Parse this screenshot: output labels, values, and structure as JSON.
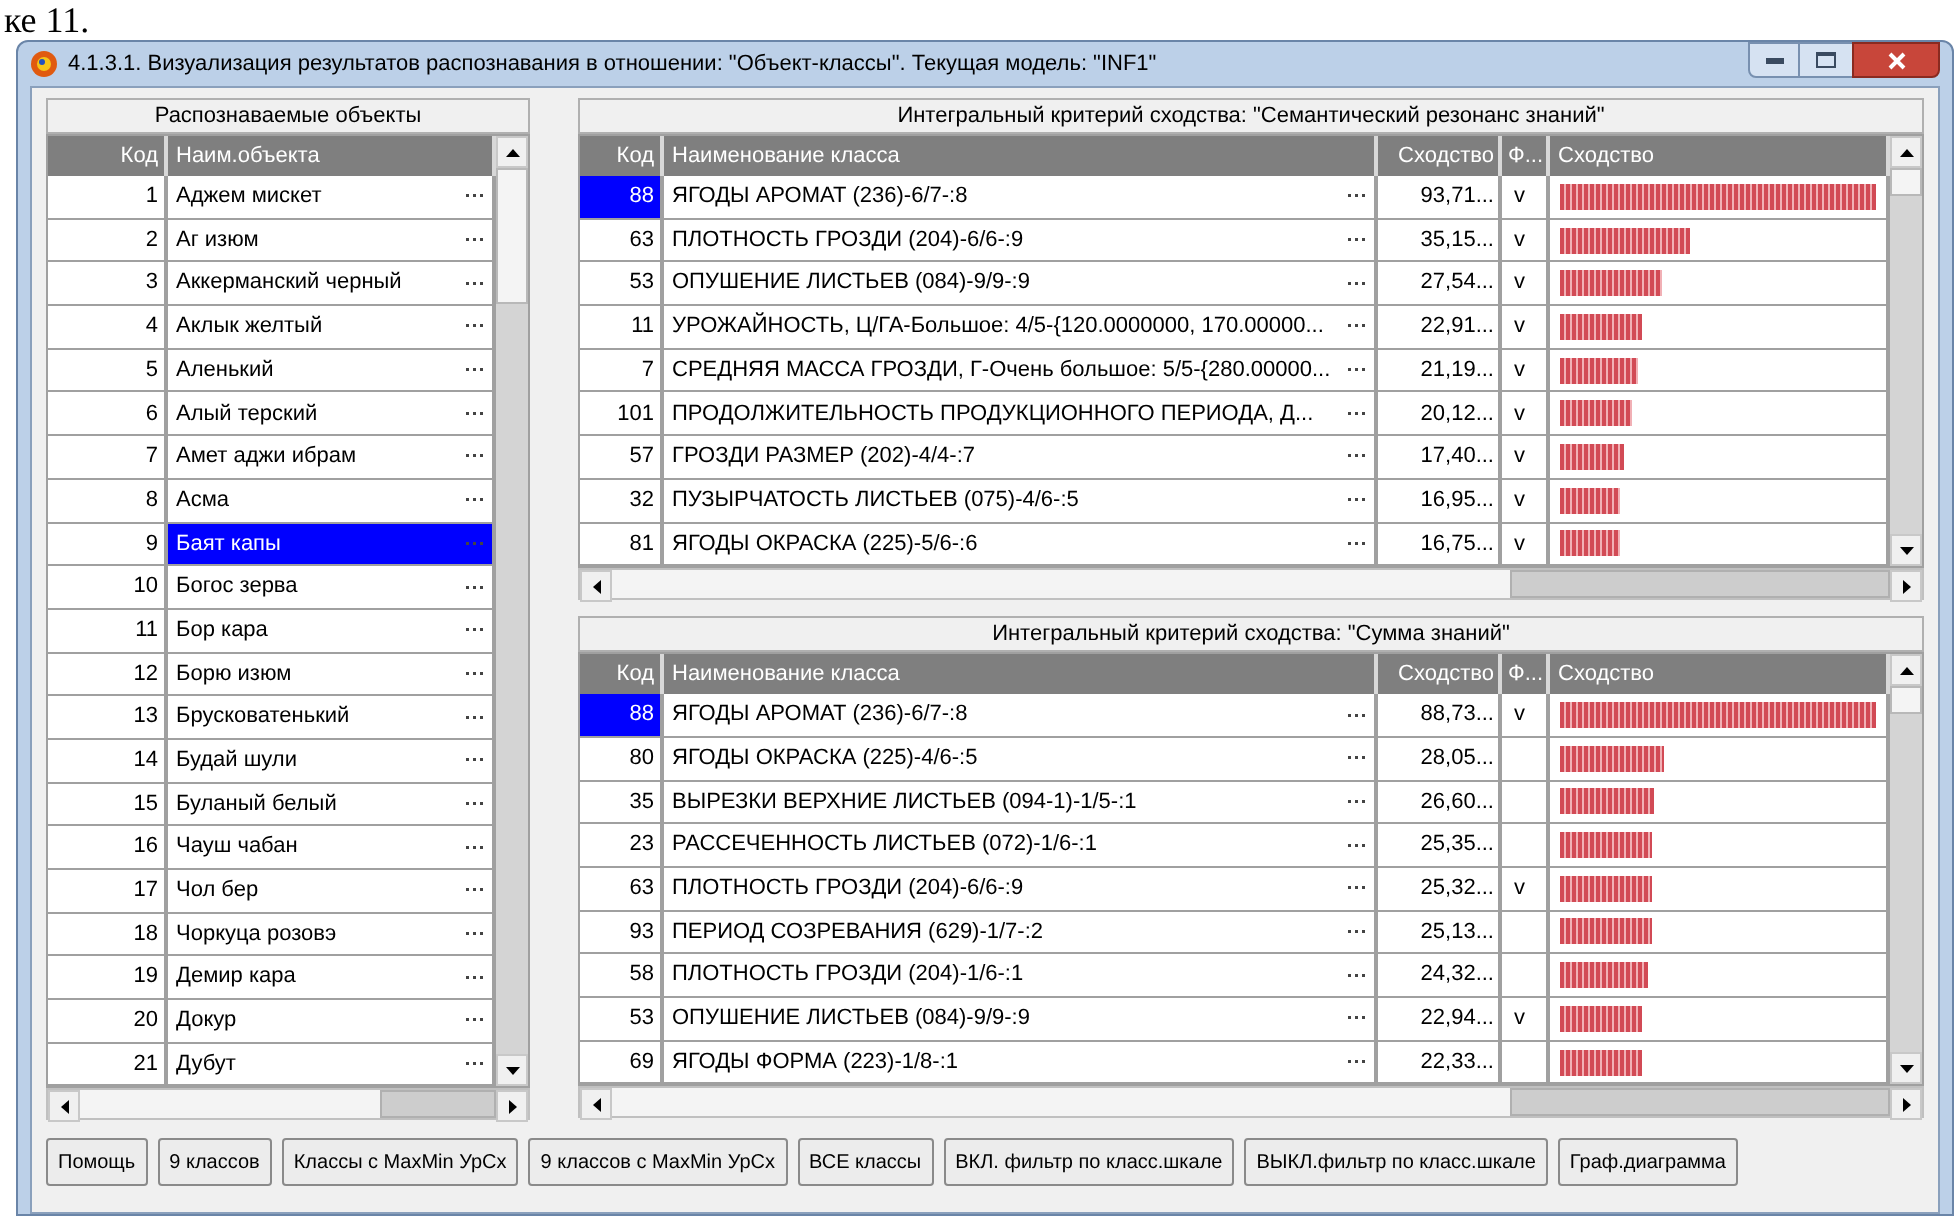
{
  "document_fragment": "ке 11.",
  "window": {
    "title": "4.1.3.1. Визуализация результатов распознавания в отношении: \"Объект-классы\". Текущая модель: \"INF1\""
  },
  "objects_panel": {
    "title": "Распознаваемые объекты",
    "columns": [
      "Код",
      "Наим.объекта"
    ],
    "rows": [
      {
        "code": "1",
        "name": "Аджем мискет",
        "selected": false
      },
      {
        "code": "2",
        "name": "Аг изюм",
        "selected": false
      },
      {
        "code": "3",
        "name": "Аккерманский черный",
        "selected": false
      },
      {
        "code": "4",
        "name": "Аклык желтый",
        "selected": false
      },
      {
        "code": "5",
        "name": "Аленький",
        "selected": false
      },
      {
        "code": "6",
        "name": "Алый терский",
        "selected": false
      },
      {
        "code": "7",
        "name": "Амет аджи ибрам",
        "selected": false
      },
      {
        "code": "8",
        "name": "Асма",
        "selected": false
      },
      {
        "code": "9",
        "name": "Баят капы",
        "selected": true
      },
      {
        "code": "10",
        "name": "Богос зерва",
        "selected": false
      },
      {
        "code": "11",
        "name": "Бор кара",
        "selected": false
      },
      {
        "code": "12",
        "name": "Борю изюм",
        "selected": false
      },
      {
        "code": "13",
        "name": "Брусковатенький",
        "selected": false
      },
      {
        "code": "14",
        "name": "Будай шули",
        "selected": false
      },
      {
        "code": "15",
        "name": "Буланый белый",
        "selected": false
      },
      {
        "code": "16",
        "name": "Чауш чабан",
        "selected": false
      },
      {
        "code": "17",
        "name": "Чол бер",
        "selected": false
      },
      {
        "code": "18",
        "name": "Чоркуца розовэ",
        "selected": false
      },
      {
        "code": "19",
        "name": "Демир кара",
        "selected": false
      },
      {
        "code": "20",
        "name": "Докур",
        "selected": false
      },
      {
        "code": "21",
        "name": "Дубут",
        "selected": false
      }
    ]
  },
  "similarity_tables": [
    {
      "title": "Интегральный критерий сходства: \"Семантический резонанс знаний\"",
      "columns": [
        "Код",
        "Наименование класса",
        "Сходство",
        "Ф...",
        "Сходство"
      ],
      "rows": [
        {
          "code": "88",
          "name": "ЯГОДЫ АРОМАТ (236)-6/7-:8",
          "similarity": "93,71...",
          "f": "v",
          "level": 1,
          "selected": true
        },
        {
          "code": "63",
          "name": "ПЛОТНОСТЬ ГРОЗДИ (204)-6/6-:9",
          "similarity": "35,15...",
          "f": "v",
          "level": 0.41,
          "selected": false
        },
        {
          "code": "53",
          "name": "ОПУШЕНИЕ ЛИСТЬЕВ (084)-9/9-:9",
          "similarity": "27,54...",
          "f": "v",
          "level": 0.32,
          "selected": false
        },
        {
          "code": "11",
          "name": "УРОЖАЙНОСТЬ, Ц/ГА-Большое: 4/5-{120.0000000, 170.00000...",
          "similarity": "22,91...",
          "f": "v",
          "level": 0.26,
          "selected": false
        },
        {
          "code": "7",
          "name": "СРЕДНЯЯ МАССА ГРОЗДИ, Г-Очень большое: 5/5-{280.00000...",
          "similarity": "21,19...",
          "f": "v",
          "level": 0.245,
          "selected": false
        },
        {
          "code": "101",
          "name": "ПРОДОЛЖИТЕЛЬНОСТЬ ПРОДУКЦИОННОГО ПЕРИОДА, Д...",
          "similarity": "20,12...",
          "f": "v",
          "level": 0.23,
          "selected": false
        },
        {
          "code": "57",
          "name": "ГРОЗДИ РАЗМЕР (202)-4/4-:7",
          "similarity": "17,40...",
          "f": "v",
          "level": 0.2,
          "selected": false
        },
        {
          "code": "32",
          "name": "ПУЗЫРЧАТОСТЬ ЛИСТЬЕВ (075)-4/6-:5",
          "similarity": "16,95...",
          "f": "v",
          "level": 0.19,
          "selected": false
        },
        {
          "code": "81",
          "name": "ЯГОДЫ ОКРАСКА (225)-5/6-:6",
          "similarity": "16,75...",
          "f": "v",
          "level": 0.19,
          "selected": false
        }
      ]
    },
    {
      "title": "Интегральный критерий сходства: \"Сумма знаний\"",
      "columns": [
        "Код",
        "Наименование класса",
        "Сходство",
        "Ф...",
        "Сходство"
      ],
      "rows": [
        {
          "code": "88",
          "name": "ЯГОДЫ АРОМАТ (236)-6/7-:8",
          "similarity": "88,73...",
          "f": "v",
          "level": 1,
          "selected": true
        },
        {
          "code": "80",
          "name": "ЯГОДЫ ОКРАСКА (225)-4/6-:5",
          "similarity": "28,05...",
          "level": 0.33,
          "selected": false
        },
        {
          "code": "35",
          "name": "ВЫРЕЗКИ ВЕРХНИЕ ЛИСТЬЕВ (094-1)-1/5-:1",
          "similarity": "26,60...",
          "level": 0.3,
          "selected": false
        },
        {
          "code": "23",
          "name": "РАССЕЧЕННОСТЬ ЛИСТЬЕВ (072)-1/6-:1",
          "similarity": "25,35...",
          "level": 0.29,
          "selected": false
        },
        {
          "code": "63",
          "name": "ПЛОТНОСТЬ ГРОЗДИ (204)-6/6-:9",
          "similarity": "25,32...",
          "f": "v",
          "level": 0.29,
          "selected": false
        },
        {
          "code": "93",
          "name": "ПЕРИОД СОЗРЕВАНИЯ (629)-1/7-:2",
          "similarity": "25,13...",
          "level": 0.29,
          "selected": false
        },
        {
          "code": "58",
          "name": "ПЛОТНОСТЬ ГРОЗДИ (204)-1/6-:1",
          "similarity": "24,32...",
          "level": 0.28,
          "selected": false
        },
        {
          "code": "53",
          "name": "ОПУШЕНИЕ ЛИСТЬЕВ (084)-9/9-:9",
          "similarity": "22,94...",
          "f": "v",
          "level": 0.26,
          "selected": false
        },
        {
          "code": "69",
          "name": "ЯГОДЫ ФОРМА (223)-1/8-:1",
          "similarity": "22,33...",
          "level": 0.26,
          "selected": false
        }
      ]
    }
  ],
  "buttons": [
    "Помощь",
    "9 классов",
    "Классы с MaxMin УрСх",
    "9 классов с MaxMin УрСх",
    "ВСЕ классы",
    "ВКЛ. фильтр по класс.шкале",
    "ВЫКЛ.фильтр по класс.шкале",
    "Граф.диаграмма"
  ]
}
